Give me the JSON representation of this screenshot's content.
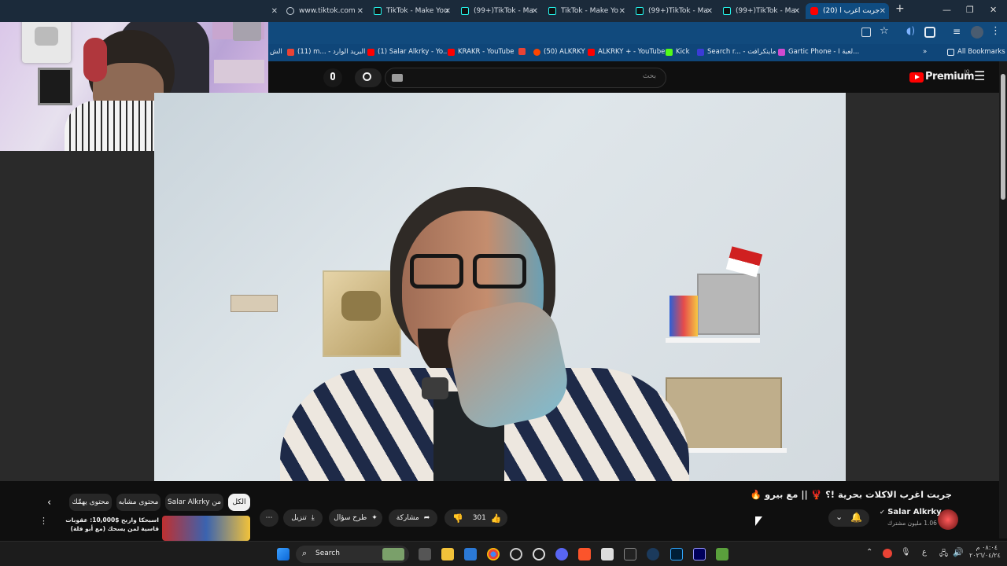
{
  "browser": {
    "tabs": [
      {
        "label": "www.tiktok.com",
        "icon": "globe-icon"
      },
      {
        "label": "TikTok - Make You",
        "icon": "tiktok-icon"
      },
      {
        "label": "(99+)TikTok - Ma",
        "icon": "tiktok-icon"
      },
      {
        "label": "TikTok - Make Yo",
        "icon": "tiktok-icon"
      },
      {
        "label": "(99+)TikTok - Ma",
        "icon": "tiktok-icon"
      },
      {
        "label": "(99+)TikTok - Ma",
        "icon": "tiktok-icon"
      },
      {
        "label": "(20) جربت اغرب ا",
        "icon": "youtube-icon",
        "active": true
      }
    ],
    "new_tab": "+",
    "bookmarks": [
      {
        "label": "الش",
        "color": "#9aa7b4"
      },
      {
        "label": "(11) m... - البريد الوارد",
        "color": "#ea4335"
      },
      {
        "label": "(1) Salar Alkrky - Yo...",
        "color": "#ff0000"
      },
      {
        "label": "KRAKR - YouTube",
        "color": "#ff0000"
      },
      {
        "label": "(50) ALKRKY",
        "color": "#ff4500"
      },
      {
        "label": "ALKRKY + - YouTube",
        "color": "#ff0000"
      },
      {
        "label": "Kick",
        "color": "#53fc18"
      },
      {
        "label": "Search r... - ماينكرافت",
        "color": "#3b3bd6"
      },
      {
        "label": "Gartic Phone - لعبة ا...",
        "color": "#d04ad0"
      }
    ],
    "all_bookmarks": "All Bookmarks",
    "more": "»"
  },
  "youtube": {
    "logo_text": "Premium",
    "logo_suffix": "IQ",
    "search_placeholder": "بحث",
    "video": {
      "title": "جربت اغرب الاكلات بحرية !؟ 🦞 || مع بيرو 🔥",
      "channel": "Salar Alkrky",
      "subscribers": "1.06 مليون مشترك",
      "likes": "301",
      "share": "مشاركة",
      "ask": "طرح سؤال",
      "download": "تنزيل"
    },
    "chips": [
      {
        "label": "الكل",
        "selected": true
      },
      {
        "label": "من Salar Alkrky"
      },
      {
        "label": "محتوى مشابه"
      },
      {
        "label": "محتوى يهمّك"
      }
    ],
    "recommended": {
      "title": "اسبحكا واربح $10,000: عقوبات قاسية لمن يسحك (مع أبو فلة)"
    }
  },
  "taskbar": {
    "search_label": "Search",
    "language": "ع",
    "time": "٠٨:٠٤ م",
    "date": "٢٠٢٦/٠٤/٢٤"
  },
  "colors": {
    "youtube_red": "#ff0000",
    "chrome_tab_bar": "#1b2a3a",
    "chrome_toolbar": "#114a7d"
  }
}
